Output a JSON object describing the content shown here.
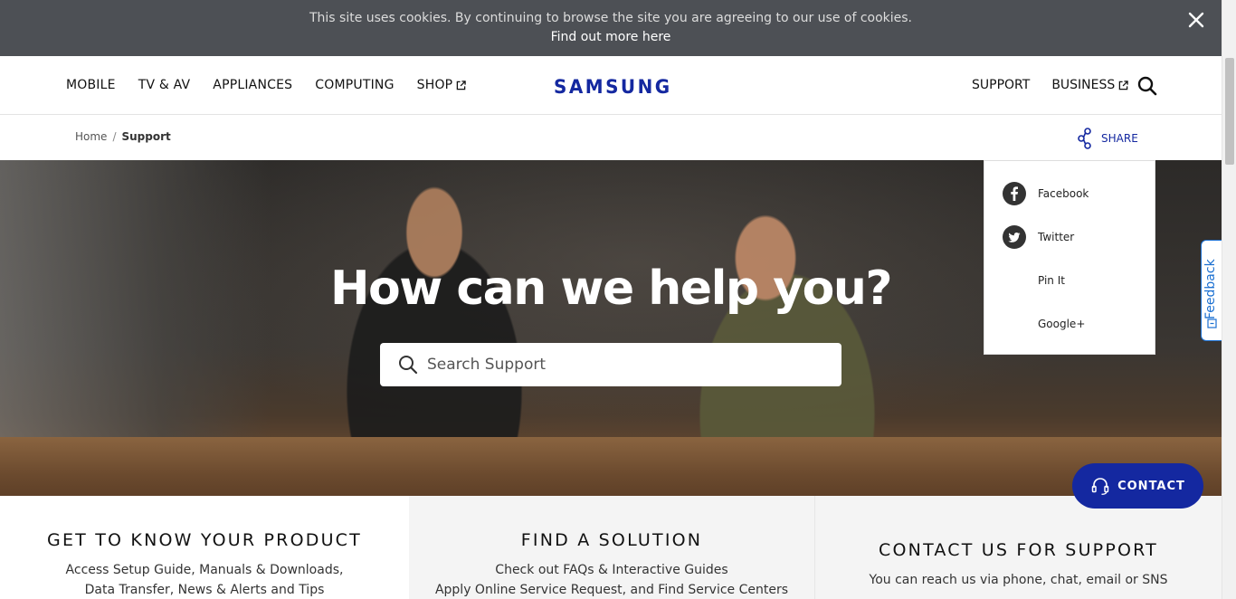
{
  "cookie_bar": {
    "message": "This site uses cookies. By continuing to browse the site you are agreeing to our use of cookies.",
    "link": "Find out more here"
  },
  "header": {
    "nav_left": [
      "MOBILE",
      "TV & AV",
      "APPLIANCES",
      "COMPUTING",
      "SHOP"
    ],
    "logo": "SAMSUNG",
    "nav_right": [
      "SUPPORT",
      "BUSINESS"
    ]
  },
  "breadcrumb": {
    "home": "Home",
    "separator": "/",
    "current": "Support"
  },
  "share": {
    "label": "SHARE",
    "items": [
      "Facebook",
      "Twitter",
      "Pin It",
      "Google+"
    ]
  },
  "hero": {
    "title": "How can we help you?",
    "search_placeholder": "Search Support"
  },
  "feedback": {
    "label": "Feedback"
  },
  "contact_button": {
    "label": "CONTACT"
  },
  "panels": [
    {
      "title": "GET TO KNOW YOUR PRODUCT",
      "lines": [
        "Access Setup Guide, Manuals & Downloads,",
        "Data Transfer, News & Alerts and Tips"
      ]
    },
    {
      "title": "FIND A SOLUTION",
      "lines": [
        "Check out FAQs & Interactive Guides",
        "Apply Online Service Request, and Find Service Centers"
      ]
    },
    {
      "title": "CONTACT US FOR SUPPORT",
      "lines": [
        "You can reach us via phone, chat, email or SNS"
      ]
    }
  ],
  "colors": {
    "brand_blue": "#1428a0",
    "cookie_bg": "#4d5055",
    "feedback_blue": "#1a6fd1"
  }
}
